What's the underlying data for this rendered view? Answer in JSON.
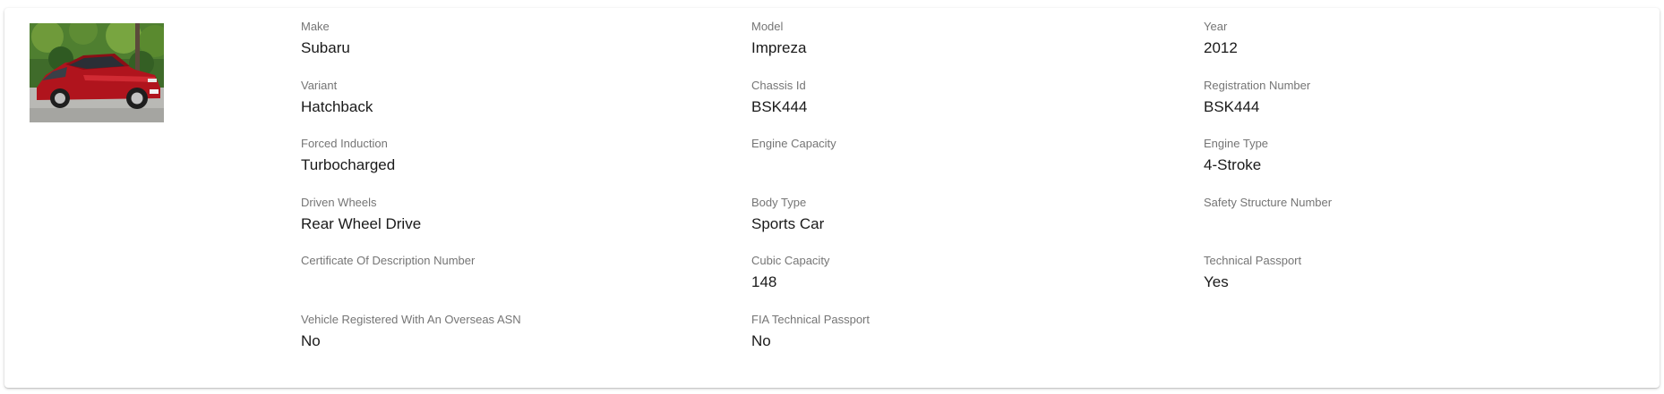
{
  "vehicle": {
    "photo_icon": "car-photo",
    "fields": [
      {
        "label": "Make",
        "value": "Subaru"
      },
      {
        "label": "Model",
        "value": "Impreza"
      },
      {
        "label": "Year",
        "value": "2012"
      },
      {
        "label": "Variant",
        "value": "Hatchback"
      },
      {
        "label": "Chassis Id",
        "value": "BSK444"
      },
      {
        "label": "Registration Number",
        "value": "BSK444"
      },
      {
        "label": "Forced Induction",
        "value": "Turbocharged"
      },
      {
        "label": "Engine Capacity",
        "value": ""
      },
      {
        "label": "Engine Type",
        "value": "4-Stroke"
      },
      {
        "label": "Driven Wheels",
        "value": "Rear Wheel Drive"
      },
      {
        "label": "Body Type",
        "value": "Sports Car"
      },
      {
        "label": "Safety Structure Number",
        "value": ""
      },
      {
        "label": "Certificate Of Description Number",
        "value": ""
      },
      {
        "label": "Cubic Capacity",
        "value": "148"
      },
      {
        "label": "Technical Passport",
        "value": "Yes"
      },
      {
        "label": "Vehicle Registered With An Overseas ASN",
        "value": "No"
      },
      {
        "label": "FIA Technical Passport",
        "value": "No"
      }
    ]
  }
}
